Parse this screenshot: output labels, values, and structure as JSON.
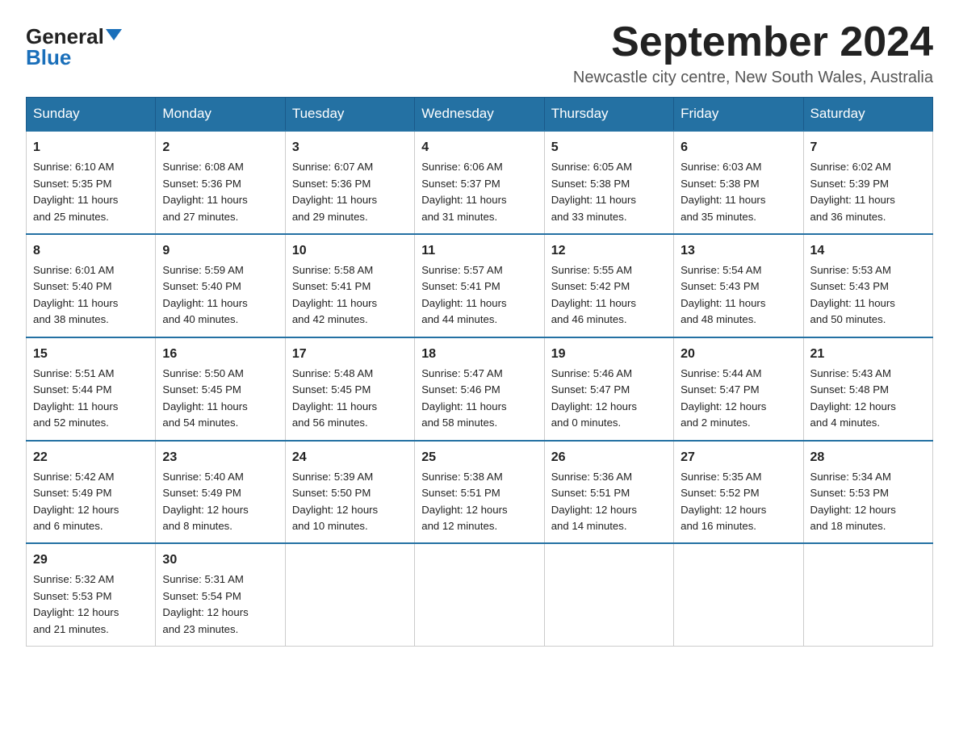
{
  "logo": {
    "general": "General",
    "blue": "Blue"
  },
  "title": "September 2024",
  "subtitle": "Newcastle city centre, New South Wales, Australia",
  "days_of_week": [
    "Sunday",
    "Monday",
    "Tuesday",
    "Wednesday",
    "Thursday",
    "Friday",
    "Saturday"
  ],
  "weeks": [
    [
      {
        "day": "1",
        "sunrise": "6:10 AM",
        "sunset": "5:35 PM",
        "daylight": "11 hours and 25 minutes."
      },
      {
        "day": "2",
        "sunrise": "6:08 AM",
        "sunset": "5:36 PM",
        "daylight": "11 hours and 27 minutes."
      },
      {
        "day": "3",
        "sunrise": "6:07 AM",
        "sunset": "5:36 PM",
        "daylight": "11 hours and 29 minutes."
      },
      {
        "day": "4",
        "sunrise": "6:06 AM",
        "sunset": "5:37 PM",
        "daylight": "11 hours and 31 minutes."
      },
      {
        "day": "5",
        "sunrise": "6:05 AM",
        "sunset": "5:38 PM",
        "daylight": "11 hours and 33 minutes."
      },
      {
        "day": "6",
        "sunrise": "6:03 AM",
        "sunset": "5:38 PM",
        "daylight": "11 hours and 35 minutes."
      },
      {
        "day": "7",
        "sunrise": "6:02 AM",
        "sunset": "5:39 PM",
        "daylight": "11 hours and 36 minutes."
      }
    ],
    [
      {
        "day": "8",
        "sunrise": "6:01 AM",
        "sunset": "5:40 PM",
        "daylight": "11 hours and 38 minutes."
      },
      {
        "day": "9",
        "sunrise": "5:59 AM",
        "sunset": "5:40 PM",
        "daylight": "11 hours and 40 minutes."
      },
      {
        "day": "10",
        "sunrise": "5:58 AM",
        "sunset": "5:41 PM",
        "daylight": "11 hours and 42 minutes."
      },
      {
        "day": "11",
        "sunrise": "5:57 AM",
        "sunset": "5:41 PM",
        "daylight": "11 hours and 44 minutes."
      },
      {
        "day": "12",
        "sunrise": "5:55 AM",
        "sunset": "5:42 PM",
        "daylight": "11 hours and 46 minutes."
      },
      {
        "day": "13",
        "sunrise": "5:54 AM",
        "sunset": "5:43 PM",
        "daylight": "11 hours and 48 minutes."
      },
      {
        "day": "14",
        "sunrise": "5:53 AM",
        "sunset": "5:43 PM",
        "daylight": "11 hours and 50 minutes."
      }
    ],
    [
      {
        "day": "15",
        "sunrise": "5:51 AM",
        "sunset": "5:44 PM",
        "daylight": "11 hours and 52 minutes."
      },
      {
        "day": "16",
        "sunrise": "5:50 AM",
        "sunset": "5:45 PM",
        "daylight": "11 hours and 54 minutes."
      },
      {
        "day": "17",
        "sunrise": "5:48 AM",
        "sunset": "5:45 PM",
        "daylight": "11 hours and 56 minutes."
      },
      {
        "day": "18",
        "sunrise": "5:47 AM",
        "sunset": "5:46 PM",
        "daylight": "11 hours and 58 minutes."
      },
      {
        "day": "19",
        "sunrise": "5:46 AM",
        "sunset": "5:47 PM",
        "daylight": "12 hours and 0 minutes."
      },
      {
        "day": "20",
        "sunrise": "5:44 AM",
        "sunset": "5:47 PM",
        "daylight": "12 hours and 2 minutes."
      },
      {
        "day": "21",
        "sunrise": "5:43 AM",
        "sunset": "5:48 PM",
        "daylight": "12 hours and 4 minutes."
      }
    ],
    [
      {
        "day": "22",
        "sunrise": "5:42 AM",
        "sunset": "5:49 PM",
        "daylight": "12 hours and 6 minutes."
      },
      {
        "day": "23",
        "sunrise": "5:40 AM",
        "sunset": "5:49 PM",
        "daylight": "12 hours and 8 minutes."
      },
      {
        "day": "24",
        "sunrise": "5:39 AM",
        "sunset": "5:50 PM",
        "daylight": "12 hours and 10 minutes."
      },
      {
        "day": "25",
        "sunrise": "5:38 AM",
        "sunset": "5:51 PM",
        "daylight": "12 hours and 12 minutes."
      },
      {
        "day": "26",
        "sunrise": "5:36 AM",
        "sunset": "5:51 PM",
        "daylight": "12 hours and 14 minutes."
      },
      {
        "day": "27",
        "sunrise": "5:35 AM",
        "sunset": "5:52 PM",
        "daylight": "12 hours and 16 minutes."
      },
      {
        "day": "28",
        "sunrise": "5:34 AM",
        "sunset": "5:53 PM",
        "daylight": "12 hours and 18 minutes."
      }
    ],
    [
      {
        "day": "29",
        "sunrise": "5:32 AM",
        "sunset": "5:53 PM",
        "daylight": "12 hours and 21 minutes."
      },
      {
        "day": "30",
        "sunrise": "5:31 AM",
        "sunset": "5:54 PM",
        "daylight": "12 hours and 23 minutes."
      },
      null,
      null,
      null,
      null,
      null
    ]
  ],
  "labels": {
    "sunrise_prefix": "Sunrise: ",
    "sunset_prefix": "Sunset: ",
    "daylight_prefix": "Daylight: "
  }
}
